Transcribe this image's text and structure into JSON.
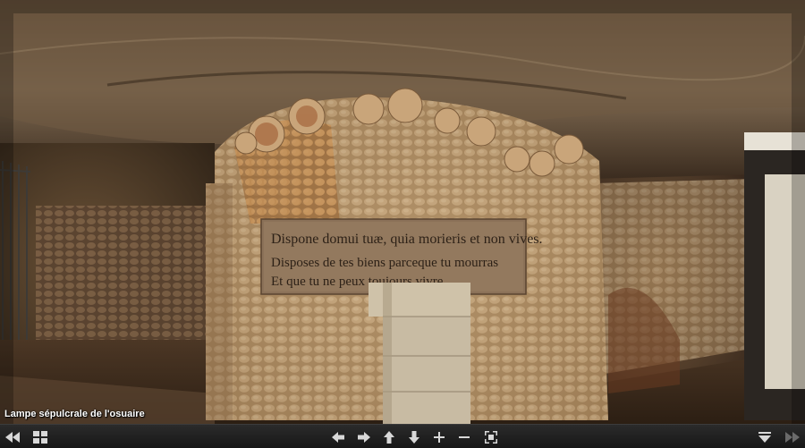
{
  "caption": "Lampe sépulcrale de l'osuaire",
  "inscription": {
    "line1": "Dispone domui tuæ, quia morieris et non vives.",
    "line2": "Disposes de tes biens parceque tu mourras",
    "line3": "Et que tu ne peux toujours vivre."
  },
  "toolbar": {
    "icons": [
      "rewind-icon",
      "grid-icon",
      "arrow-left-icon",
      "arrow-right-icon",
      "arrow-up-icon",
      "arrow-down-icon",
      "zoom-in-icon",
      "zoom-out-icon",
      "fullscreen-icon",
      "dropdown-icon",
      "forward-icon"
    ]
  },
  "colors": {
    "toolbar_bg": "#1e1e1e",
    "icon": "#d8d8d8",
    "icon_dim": "#6a6a6a"
  }
}
